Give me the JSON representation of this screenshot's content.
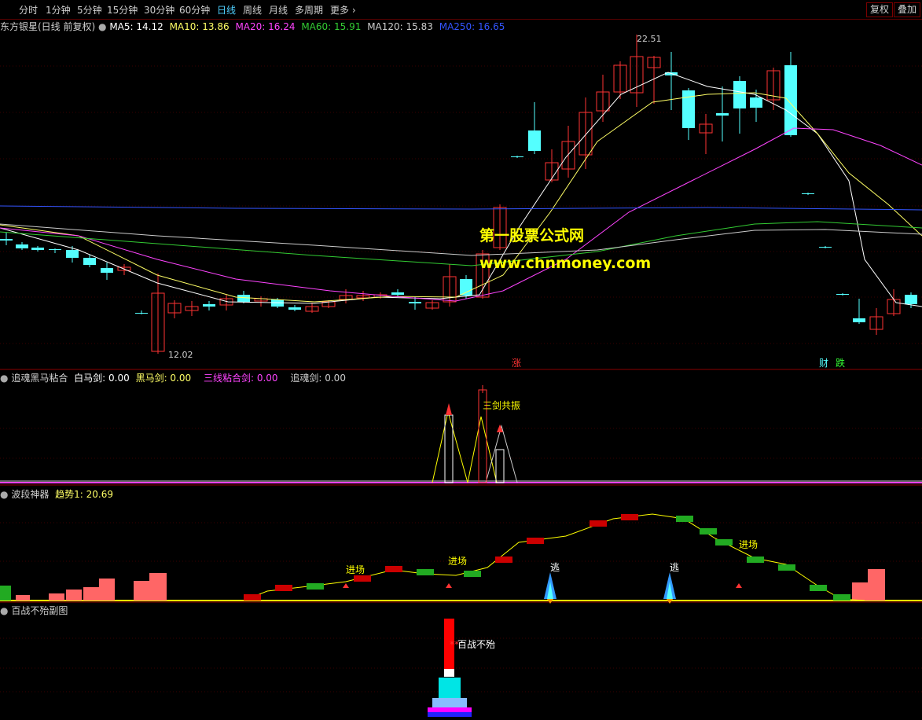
{
  "toolbar": {
    "periods": [
      "分时",
      "1分钟",
      "5分钟",
      "15分钟",
      "30分钟",
      "60分钟",
      "日线",
      "周线",
      "月线",
      "多周期",
      "更多"
    ],
    "active_period": "日线",
    "right_buttons": [
      "复权",
      "叠加"
    ]
  },
  "main_panel": {
    "stock_title": "东方银星(日线 前复权)",
    "ma_legend": [
      {
        "label": "MA5: 14.12",
        "color": "#ffffff"
      },
      {
        "label": "MA10: 13.86",
        "color": "#ffff66"
      },
      {
        "label": "MA20: 16.24",
        "color": "#ff44ff"
      },
      {
        "label": "MA60: 15.91",
        "color": "#33cc33"
      },
      {
        "label": "MA120: 15.83",
        "color": "#cccccc"
      },
      {
        "label": "MA250: 16.65",
        "color": "#3355ff"
      }
    ],
    "high_label": "22.51",
    "low_label": "12.02",
    "watermark_cn": "第一股票公式网",
    "watermark_url": "www.chnmoney.com",
    "markers": [
      "涨",
      "财",
      "跌"
    ]
  },
  "panel2": {
    "title": "追魂黑马粘合",
    "legend": [
      {
        "label": "白马剑: 0.00",
        "color": "#ffffff"
      },
      {
        "label": "黑马剑: 0.00",
        "color": "#ffff66"
      },
      {
        "label": "三线粘合剑: 0.00",
        "color": "#ff44ff"
      },
      {
        "label": "追魂剑: 0.00",
        "color": "#cccccc"
      }
    ],
    "annotation": "三剑共振"
  },
  "panel3": {
    "title": "波段神器",
    "legend_label": "趋势1: 20.69",
    "annotations": [
      "进场",
      "进场",
      "进场",
      "逃",
      "逃"
    ]
  },
  "panel4": {
    "title": "百战不殆副图",
    "annotation": "百战不殆"
  },
  "colors": {
    "up": "#ff3333",
    "down": "#54ffff",
    "toolbar_active": "#4fd0ff",
    "panel_border": "#8b0000"
  }
}
